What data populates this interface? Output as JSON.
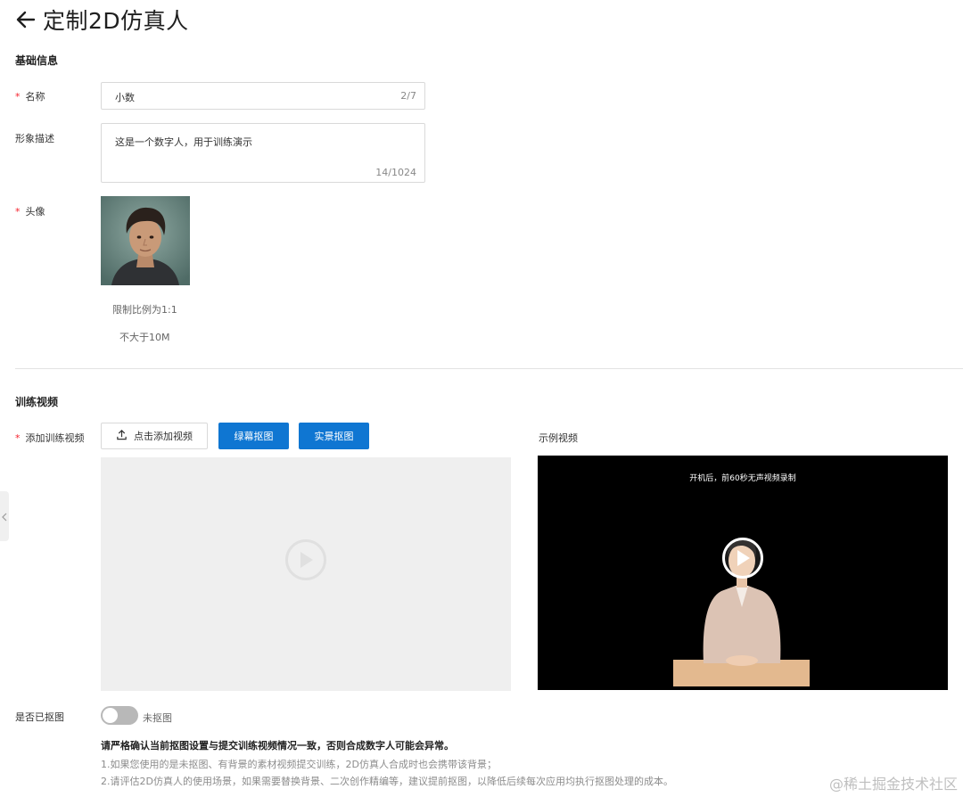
{
  "header": {
    "title": "定制2D仿真人"
  },
  "basic": {
    "section_title": "基础信息",
    "name_label": "名称",
    "name_value": "小数",
    "name_counter": "2/7",
    "desc_label": "形象描述",
    "desc_value": "这是一个数字人，用于训练演示",
    "desc_counter": "14/1024",
    "avatar_label": "头像",
    "avatar_hint_ratio": "限制比例为1:1",
    "avatar_hint_size": "不大于10M"
  },
  "training": {
    "section_title": "训练视频",
    "add_label": "添加训练视频",
    "upload_button": "点击添加视频",
    "green_screen_button": "绿幕抠图",
    "real_scene_button": "实景抠图",
    "sample_label": "示例视频",
    "sample_caption": "开机后，前60秒无声视频录制"
  },
  "matting": {
    "label": "是否已抠图",
    "toggle_text": "未抠图",
    "toggle_on": false
  },
  "notes": {
    "warning": "请严格确认当前抠图设置与提交训练视频情况一致，否则合成数字人可能会异常。",
    "line1": "1.如果您使用的是未抠图、有背景的素材视频提交训练，2D仿真人合成时也会携带该背景；",
    "line2": "2.请评估2D仿真人的使用场景，如果需要替换背景、二次创作精编等，建议提前抠图，以降低后续每次应用均执行抠图处理的成本。"
  },
  "watermark": "@稀土掘金技术社区",
  "colors": {
    "primary": "#0f76d2",
    "required": "#f5222d",
    "toggle_off": "#b8b8b8"
  }
}
